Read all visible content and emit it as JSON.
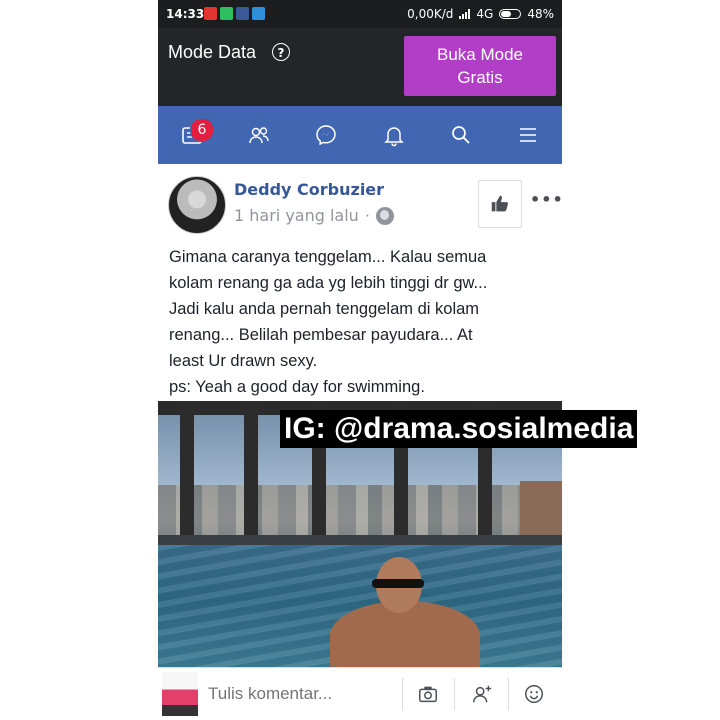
{
  "status_bar": {
    "time": "14:33",
    "speed": "0,00K/d",
    "network": "4G",
    "battery": "48%"
  },
  "mode_bar": {
    "label": "Mode Data",
    "help_symbol": "?",
    "free_mode_button": "Buka Mode Gratis"
  },
  "nav": {
    "items": [
      {
        "icon": "news-feed-icon",
        "badge": "6"
      },
      {
        "icon": "friends-icon"
      },
      {
        "icon": "messenger-icon"
      },
      {
        "icon": "notifications-icon"
      },
      {
        "icon": "search-icon"
      },
      {
        "icon": "menu-icon"
      }
    ]
  },
  "post": {
    "author": "Deddy Corbuzier",
    "time": "1 hari yang lalu",
    "separator": "·",
    "text_lines": [
      "Gimana caranya tenggelam... Kalau semua",
      "kolam renang ga ada yg lebih tinggi dr gw...",
      "Jadi kalu anda pernah tenggelam di kolam",
      "renang... Belilah pembesar payudara... At",
      "least Ur drawn sexy.",
      "ps: Yeah a good day for swimming."
    ]
  },
  "watermark": "IG: @drama.sosialmedia",
  "comment_bar": {
    "placeholder": "Tulis komentar..."
  },
  "colors": {
    "nav_blue": "#4267b2",
    "author_blue": "#365899",
    "free_button": "#b23ec8",
    "badge_red": "#e41e3f"
  }
}
